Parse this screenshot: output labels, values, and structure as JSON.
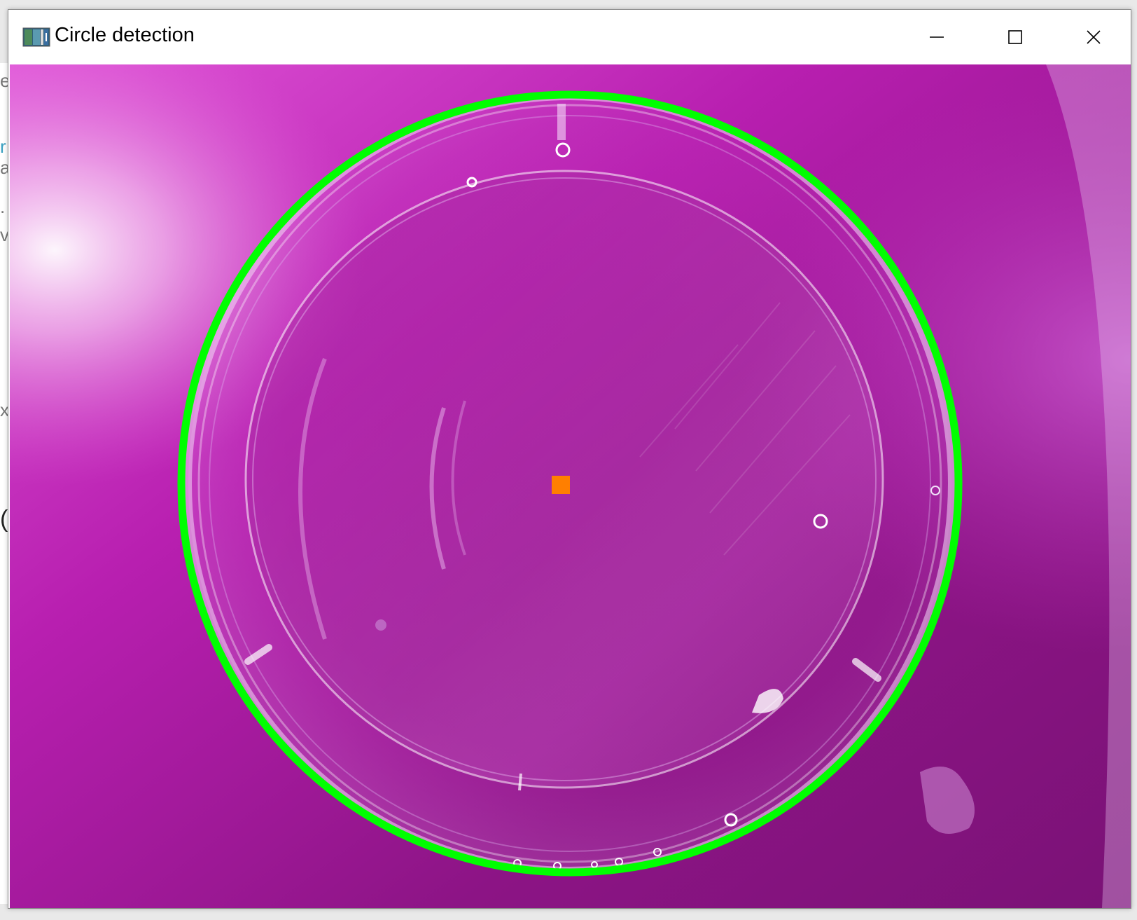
{
  "window": {
    "title": "Circle detection",
    "icon": "opencv-window-icon",
    "controls": {
      "minimize": "minimize-icon",
      "maximize": "maximize-icon",
      "close": "close-icon"
    }
  },
  "image": {
    "description_icon": "camera-frame",
    "background_color": "#b01aa8",
    "detected_circle_color": "#00ff00",
    "center_marker_color": "#ff7f00"
  },
  "background_peek": {
    "chars": [
      "e",
      "r",
      "a",
      ".",
      "v",
      "x",
      "("
    ]
  }
}
